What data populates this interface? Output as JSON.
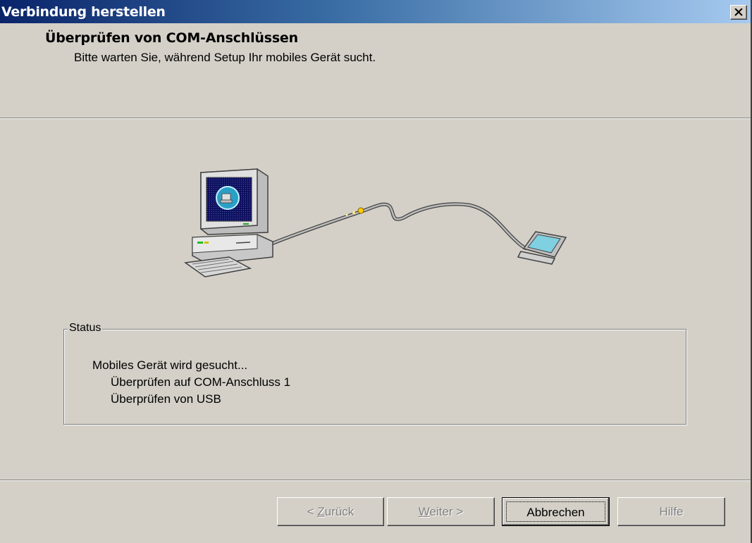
{
  "window": {
    "title": "Verbindung herstellen"
  },
  "header": {
    "title": "Überprüfen von COM-Anschlüssen",
    "subtitle": "Bitte warten Sie, während Setup Ihr mobiles Gerät sucht."
  },
  "status": {
    "legend": "Status",
    "lines": [
      "Mobiles Gerät wird gesucht...",
      "Überprüfen auf COM-Anschluss 1",
      "Überprüfen von USB"
    ]
  },
  "buttons": {
    "back": {
      "prefix": "< ",
      "mnemonic": "Z",
      "rest": "urück",
      "enabled": false
    },
    "next": {
      "mnemonic": "W",
      "rest": "eiter >",
      "enabled": false
    },
    "cancel": {
      "label": "Abbrechen",
      "enabled": true,
      "focused": true
    },
    "help": {
      "label": "Hilfe",
      "enabled": false
    }
  },
  "icons": {
    "close": "close-icon",
    "illustration": "pc-to-mobile-connection-illustration"
  },
  "colors": {
    "titlebar_start": "#0a246a",
    "titlebar_end": "#a6caf0",
    "dialog_bg": "#d4d0c8"
  }
}
